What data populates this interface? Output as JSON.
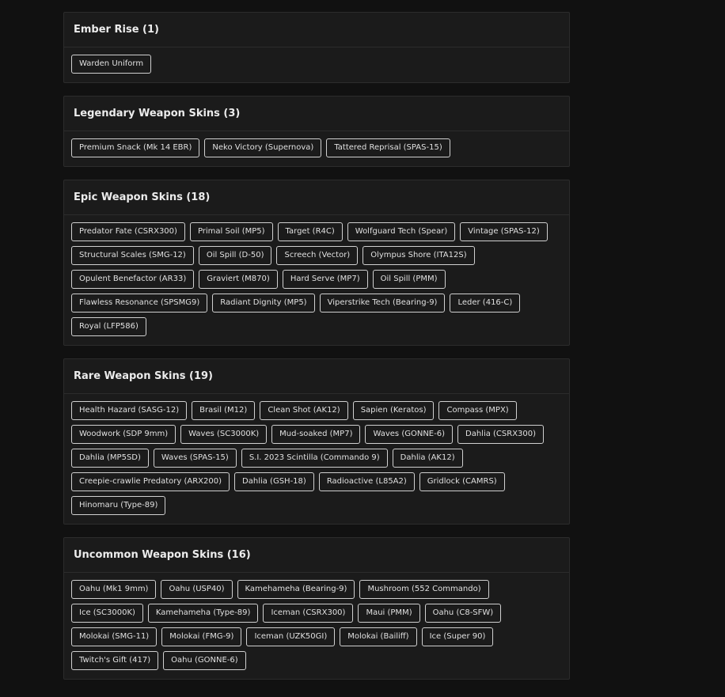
{
  "sections": [
    {
      "title": "Ember Rise (1)",
      "items": [
        "Warden Uniform"
      ]
    },
    {
      "title": "Legendary Weapon Skins (3)",
      "items": [
        "Premium Snack (Mk 14 EBR)",
        "Neko Victory (Supernova)",
        "Tattered Reprisal (SPAS-15)"
      ]
    },
    {
      "title": "Epic Weapon Skins (18)",
      "items": [
        "Predator Fate (CSRX300)",
        "Primal Soil (MP5)",
        "Target (R4C)",
        "Wolfguard Tech (Spear)",
        "Vintage (SPAS-12)",
        "Structural Scales (SMG-12)",
        "Oil Spill (D-50)",
        "Screech (Vector)",
        "Olympus Shore (ITA12S)",
        "Opulent Benefactor (AR33)",
        "Graviert (M870)",
        "Hard Serve (MP7)",
        "Oil Spill (PMM)",
        "Flawless Resonance (SPSMG9)",
        "Radiant Dignity (MP5)",
        "Viperstrike Tech (Bearing-9)",
        "Leder (416-C)",
        "Royal (LFP586)"
      ]
    },
    {
      "title": "Rare Weapon Skins (19)",
      "items": [
        "Health Hazard (SASG-12)",
        "Brasil (M12)",
        "Clean Shot (AK12)",
        "Sapien (Keratos)",
        "Compass (MPX)",
        "Woodwork (SDP 9mm)",
        "Waves (SC3000K)",
        "Mud-soaked (MP7)",
        "Waves (GONNE-6)",
        "Dahlia (CSRX300)",
        "Dahlia (MP5SD)",
        "Waves (SPAS-15)",
        "S.I. 2023 Scintilla (Commando 9)",
        "Dahlia (AK12)",
        "Creepie-crawlie Predatory (ARX200)",
        "Dahlia (GSH-18)",
        "Radioactive (L85A2)",
        "Gridlock (CAMRS)",
        "Hinomaru (Type-89)"
      ]
    },
    {
      "title": "Uncommon Weapon Skins (16)",
      "items": [
        "Oahu (Mk1 9mm)",
        "Oahu (USP40)",
        "Kamehameha (Bearing-9)",
        "Mushroom (552 Commando)",
        "Ice (SC3000K)",
        "Kamehameha (Type-89)",
        "Iceman (CSRX300)",
        "Maui (PMM)",
        "Oahu (C8-SFW)",
        "Molokai (SMG-11)",
        "Molokai (FMG-9)",
        "Iceman (UZK50GI)",
        "Molokai (Bailiff)",
        "Ice (Super 90)",
        "Twitch's Gift (417)",
        "Oahu (GONNE-6)"
      ]
    }
  ]
}
